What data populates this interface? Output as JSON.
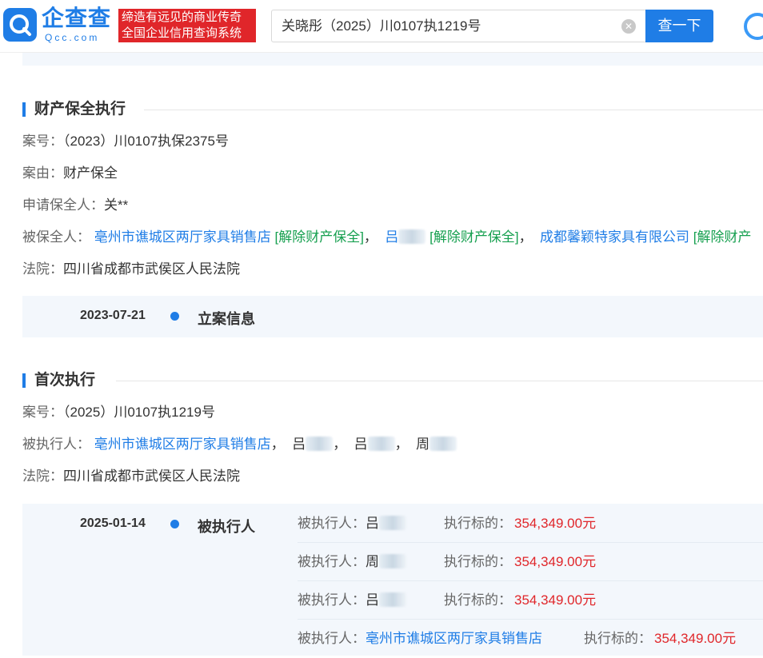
{
  "header": {
    "logo_text": "企查查",
    "logo_sub": "Qcc.com",
    "slogan_line1": "缔造有远见的商业传奇",
    "slogan_line2": "全国企业信用查询系统",
    "search_value": "关晓彤（2025）川0107执1219号",
    "search_button": "查一下",
    "icons": {
      "clear": "clear-icon",
      "logo": "qcc-logo-icon",
      "corner": "app-logo-icon"
    }
  },
  "colors": {
    "brand": "#1f7de6",
    "slogan_bg": "#e0262a",
    "tag_green": "#17a050",
    "amount_red": "#e0262a",
    "panel_bg": "#f3f7fc"
  },
  "section1": {
    "title": "财产保全执行",
    "case_no_label": "案号：",
    "case_no": "（2023）川0107执保2375号",
    "cause_label": "案由：",
    "cause": "财产保全",
    "applicant_label": "申请保全人：",
    "applicant": "关**",
    "respondent_label": "被保全人：",
    "respondents": [
      {
        "name": "亳州市谯城区两厅家具销售店",
        "tag": "[解除财产保全]",
        "sep": "，"
      },
      {
        "name": "吕",
        "tag": "[解除财产保全]",
        "sep": "，"
      },
      {
        "name": "成都馨颖特家具有限公司",
        "tag": "[解除财产"
      }
    ],
    "court_label": "法院：",
    "court": "四川省成都市武侯区人民法院",
    "timeline": {
      "date": "2023-07-21",
      "title": "立案信息"
    }
  },
  "section2": {
    "title": "首次执行",
    "case_no_label": "案号：",
    "case_no": "（2025）川0107执1219号",
    "executed_label": "被执行人：",
    "executed": [
      {
        "name": "亳州市谯城区两厅家具销售店",
        "sep": "，"
      },
      {
        "name": "吕",
        "sep": "，"
      },
      {
        "name": "吕",
        "sep": "，"
      },
      {
        "name": "周"
      }
    ],
    "court_label": "法院：",
    "court": "四川省成都市武侯区人民法院",
    "timeline": {
      "date": "2025-01-14",
      "title": "被执行人",
      "rows": [
        {
          "label": "被执行人：",
          "name": "吕",
          "amount_label": "执行标的：",
          "amount": "354,349.00元"
        },
        {
          "label": "被执行人：",
          "name": "周",
          "amount_label": "执行标的：",
          "amount": "354,349.00元"
        },
        {
          "label": "被执行人：",
          "name": "吕",
          "amount_label": "执行标的：",
          "amount": "354,349.00元"
        },
        {
          "label": "被执行人：",
          "name": "亳州市谯城区两厅家具销售店",
          "amount_label": "执行标的：",
          "amount": "354,349.00元"
        }
      ]
    }
  }
}
